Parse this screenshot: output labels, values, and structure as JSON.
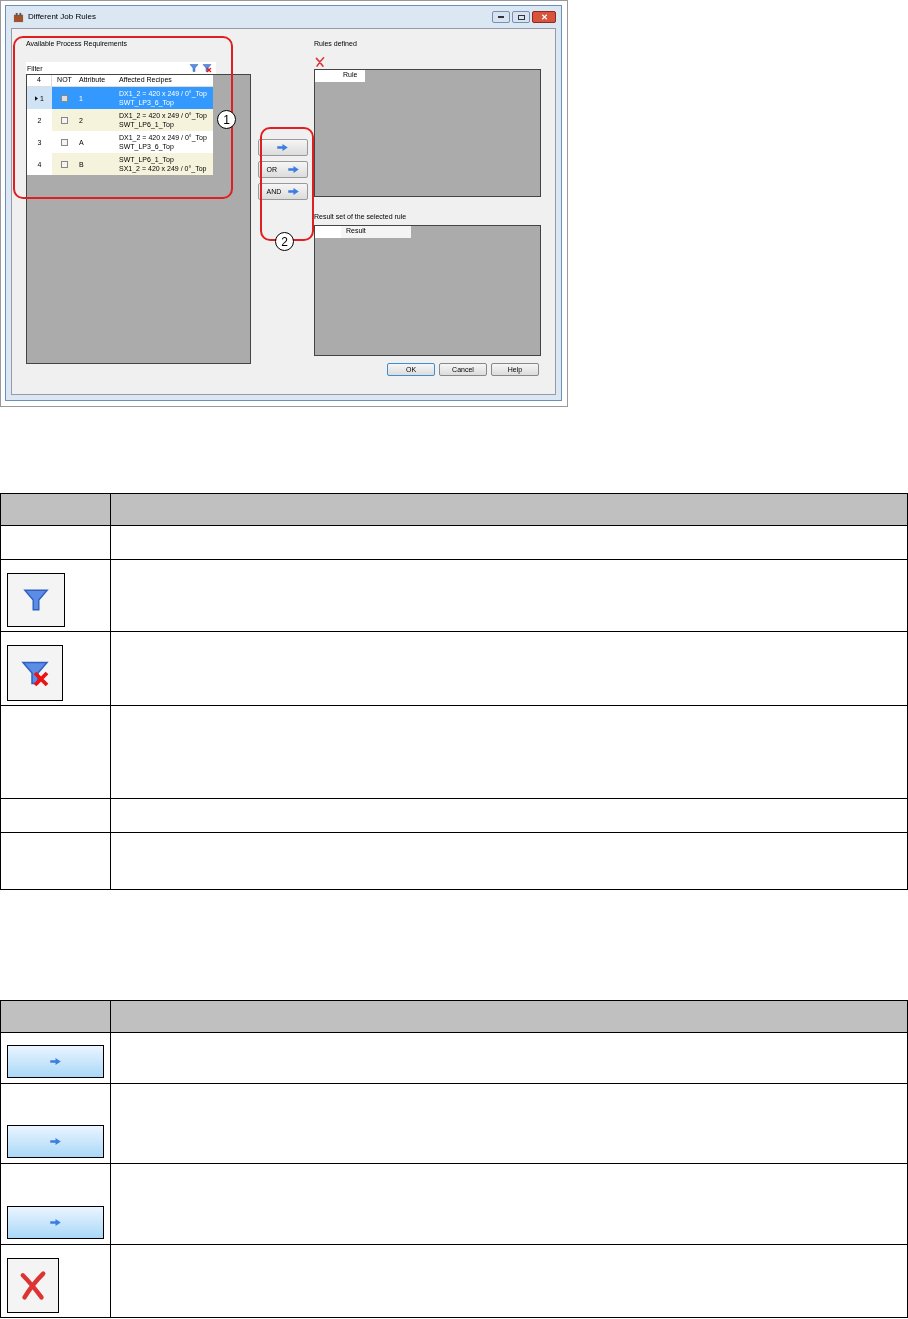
{
  "window": {
    "title": "Different Job Rules"
  },
  "requirements": {
    "label": "Available Process Requirements",
    "filter_label": "Filter",
    "columns": [
      "4",
      "NOT",
      "Attribute",
      "Affected Recipes"
    ],
    "rows": [
      {
        "number": "1",
        "checked": false,
        "attribute": "1",
        "recipes": [
          "DX1_2 = 420 x 249 / 0°_Top",
          "SWT_LP3_6_Top"
        ],
        "selected": true
      },
      {
        "number": "2",
        "checked": false,
        "attribute": "2",
        "recipes": [
          "DX1_2 = 420 x 249 / 0°_Top",
          "SWT_LP6_1_Top"
        ],
        "selected": false
      },
      {
        "number": "3",
        "checked": false,
        "attribute": "A",
        "recipes": [
          "DX1_2 = 420 x 249 / 0°_Top",
          "SWT_LP3_6_Top"
        ],
        "selected": false
      },
      {
        "number": "4",
        "checked": false,
        "attribute": "B",
        "recipes": [
          "SWT_LP6_1_Top",
          "SX1_2 = 420 x 249 / 0°_Top"
        ],
        "selected": false
      }
    ]
  },
  "transfer_buttons": [
    {
      "kind": "arrow"
    },
    {
      "kind": "labeled",
      "label": "OR"
    },
    {
      "kind": "labeled",
      "label": "AND"
    }
  ],
  "rules": {
    "label": "Rules defined",
    "column": "Rule"
  },
  "result": {
    "label": "Result set of the selected rule",
    "column": "Result"
  },
  "buttons": [
    "OK",
    "Cancel",
    "Help"
  ],
  "callouts": [
    "1",
    "2"
  ],
  "legend_tables": [
    {
      "rows": [
        {
          "kind": "blank"
        },
        {
          "kind": "filter"
        },
        {
          "kind": "clearfilter"
        },
        {
          "kind": "blank"
        },
        {
          "kind": "blank"
        },
        {
          "kind": "blank"
        }
      ]
    },
    {
      "rows": [
        {
          "kind": "arrow"
        },
        {
          "kind": "arrow"
        },
        {
          "kind": "arrow"
        },
        {
          "kind": "delete"
        }
      ]
    }
  ]
}
